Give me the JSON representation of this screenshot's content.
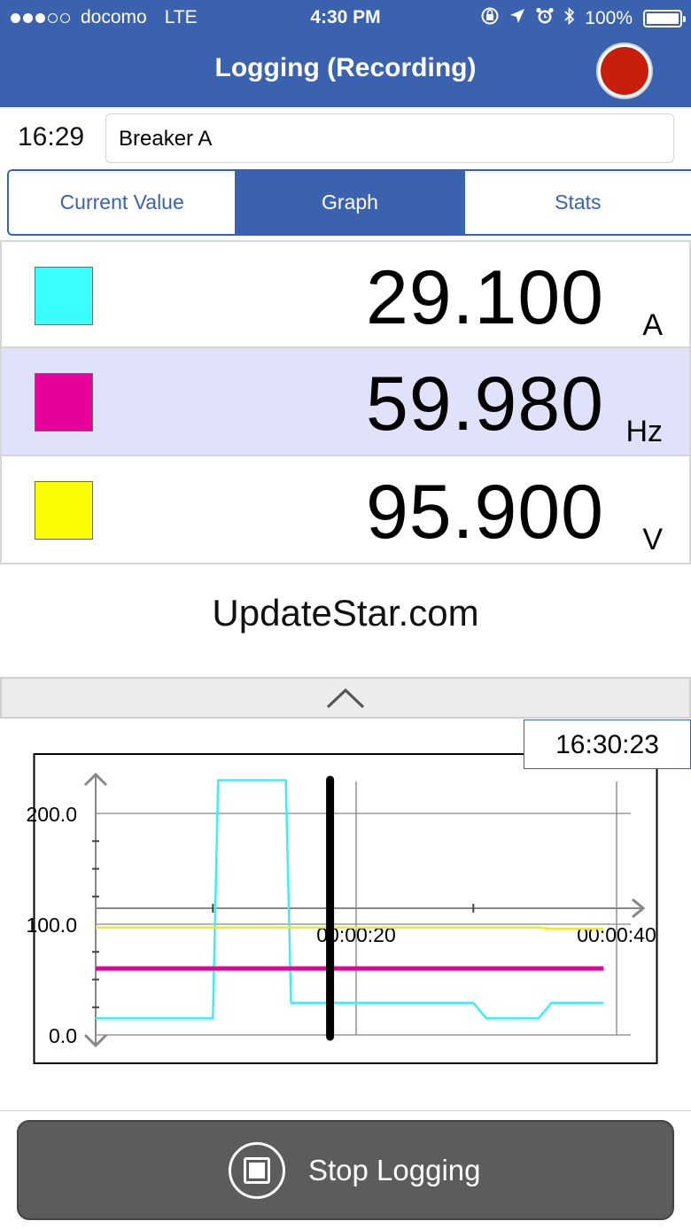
{
  "status_bar": {
    "carrier": "docomo",
    "network": "LTE",
    "time": "4:30 PM",
    "battery": "100%",
    "icons": [
      "orientation-lock-icon",
      "location-arrow-icon",
      "alarm-icon",
      "bluetooth-icon",
      "battery-icon"
    ]
  },
  "nav": {
    "title": "Logging (Recording)",
    "record_color": "#c81e0c"
  },
  "session": {
    "start_time": "16:29",
    "name": "Breaker A"
  },
  "tabs": [
    {
      "label": "Current Value",
      "active": false
    },
    {
      "label": "Graph",
      "active": true
    },
    {
      "label": "Stats",
      "active": false
    }
  ],
  "readings": [
    {
      "color": "#3cfdfd",
      "value": "29.100",
      "unit": "A"
    },
    {
      "color": "#e8009a",
      "value": "59.980",
      "unit": "Hz"
    },
    {
      "color": "#fbfc00",
      "value": "95.900",
      "unit": "V"
    }
  ],
  "watermark": "UpdateStar.com",
  "graph": {
    "cursor_time": "16:30:23",
    "accent": "#3a62ae"
  },
  "chart_data": {
    "type": "line",
    "xlabel": "",
    "ylabel": "",
    "x_tick_labels": [
      "00:00:20",
      "00:00:40"
    ],
    "y_tick_labels": [
      "200.0",
      "100.0",
      "0.0"
    ],
    "xlim": [
      0,
      40
    ],
    "ylim": [
      0,
      230
    ],
    "cursor_x": 18,
    "grid": true,
    "series": [
      {
        "color": "#3cf0f0",
        "points": [
          [
            0,
            15
          ],
          [
            9,
            15
          ],
          [
            9.4,
            230
          ],
          [
            14.6,
            230
          ],
          [
            15,
            29
          ],
          [
            29,
            29
          ],
          [
            30,
            15
          ],
          [
            34,
            15
          ],
          [
            35,
            29
          ],
          [
            39,
            29
          ]
        ]
      },
      {
        "color": "#e8009a",
        "points": [
          [
            0,
            60
          ],
          [
            39,
            60
          ]
        ]
      },
      {
        "color": "#f2f200",
        "points": [
          [
            0,
            97
          ],
          [
            34,
            97
          ],
          [
            35,
            95.9
          ],
          [
            39,
            95.9
          ]
        ]
      }
    ]
  },
  "stop_button": {
    "label": "Stop Logging"
  }
}
